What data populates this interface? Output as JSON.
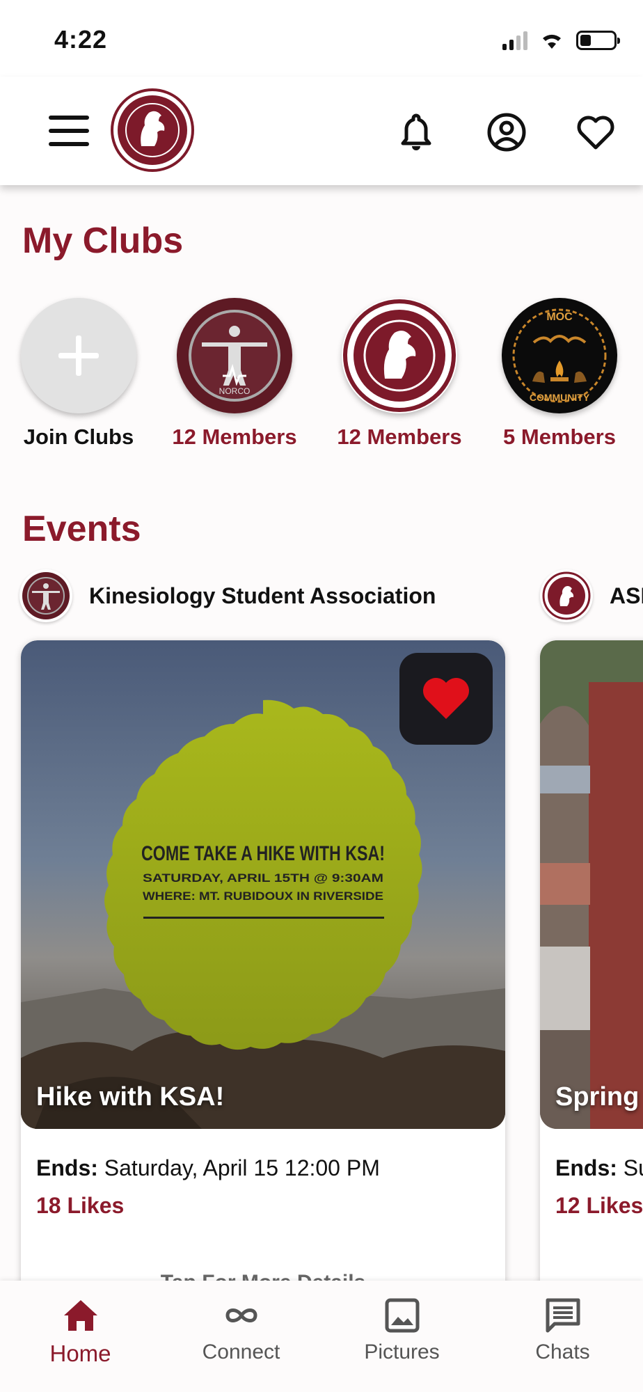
{
  "status_bar": {
    "time": "4:22"
  },
  "header": {
    "menu_icon": "hamburger-icon",
    "logo": "asnc-seal-logo",
    "icons": [
      "bell-icon",
      "profile-icon",
      "heart-icon"
    ]
  },
  "my_clubs": {
    "title": "My Clubs",
    "items": [
      {
        "label": "Join Clubs",
        "icon": "plus-icon"
      },
      {
        "label": "12 Members",
        "logo": "kinesiology-logo"
      },
      {
        "label": "12 Members",
        "logo": "asnc-logo"
      },
      {
        "label": "5 Members",
        "logo": "moc-community-logo"
      }
    ]
  },
  "events": {
    "title": "Events",
    "cards": [
      {
        "org": "Kinesiology Student Association",
        "title": "Hike with KSA!",
        "poster": {
          "headline": "COME TAKE A HIKE WITH KSA!",
          "line1": "SATURDAY, APRIL 15TH @ 9:30AM",
          "line2": "WHERE: MT. RUBIDOUX IN RIVERSIDE"
        },
        "ends_label": "Ends:",
        "ends_value": "Saturday, April 15 12:00 PM",
        "likes": "18 Likes",
        "liked": true,
        "more": "Tap For More Details"
      },
      {
        "org": "ASI",
        "title": "Spring",
        "ends_label": "Ends:",
        "ends_value": "Su",
        "likes": "12 Likes"
      }
    ]
  },
  "bottom_nav": {
    "items": [
      {
        "label": "Home",
        "icon": "home-icon",
        "active": true
      },
      {
        "label": "Connect",
        "icon": "infinity-icon",
        "active": false
      },
      {
        "label": "Pictures",
        "icon": "image-icon",
        "active": false
      },
      {
        "label": "Chats",
        "icon": "chat-icon",
        "active": false
      }
    ]
  },
  "colors": {
    "accent": "#8b1a2b",
    "liked": "#e0101a",
    "poster": "#a9b81c"
  }
}
